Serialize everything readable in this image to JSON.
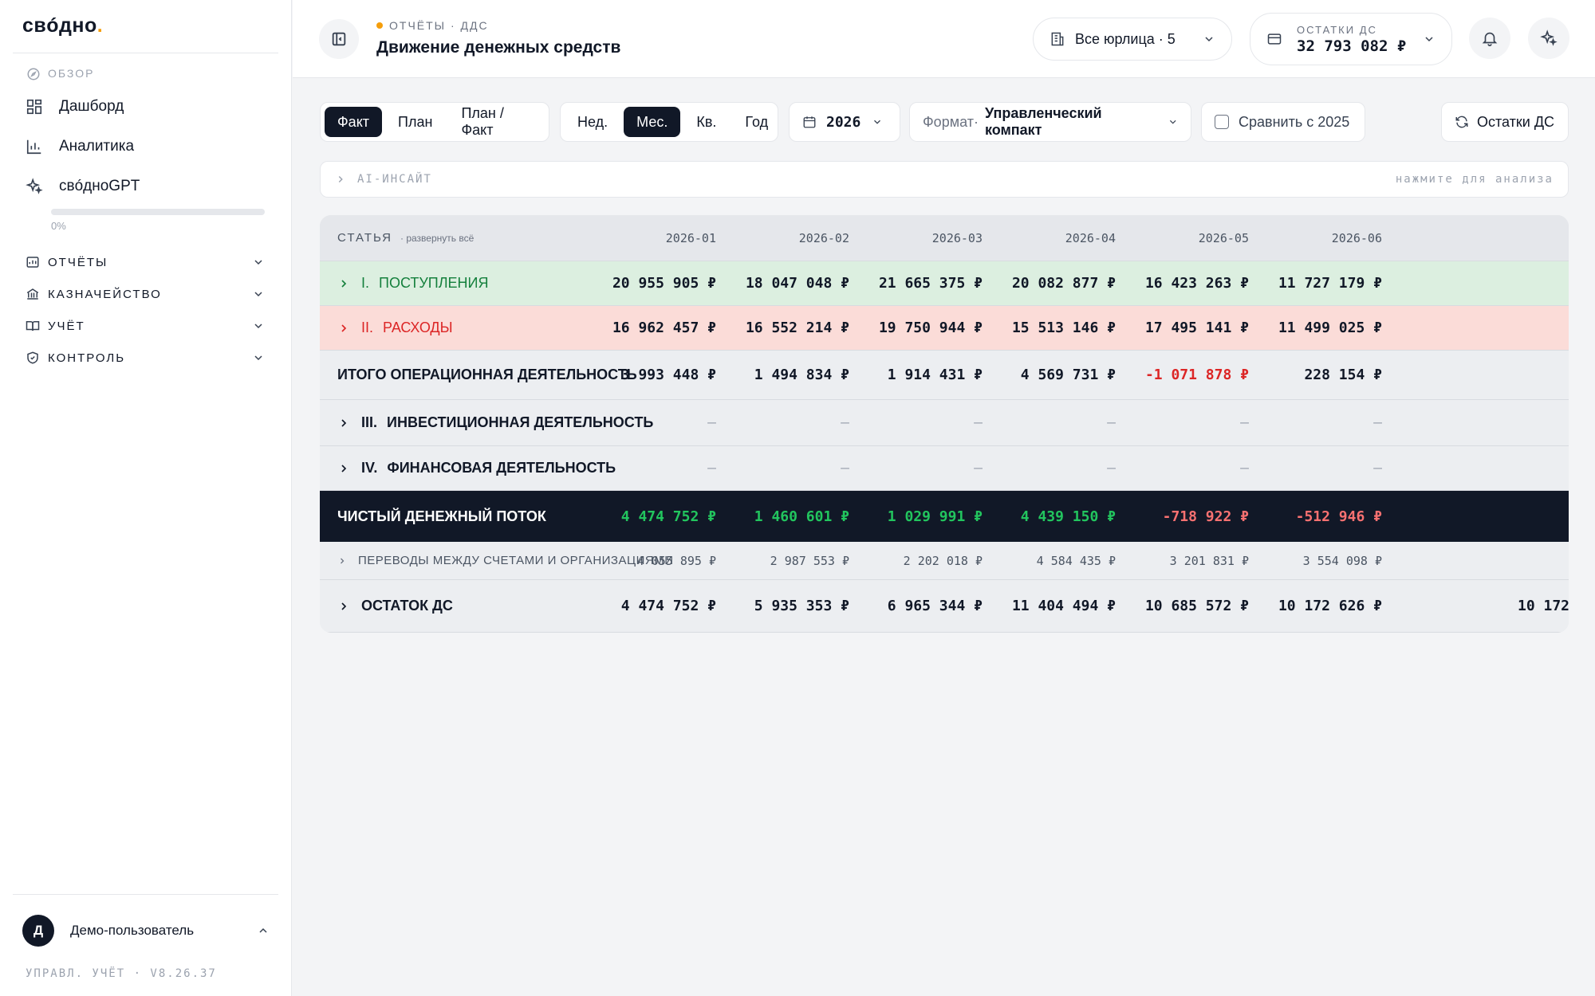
{
  "sidebar": {
    "logo": "свóдно",
    "overview_label": "ОБЗОР",
    "items": [
      {
        "label": "Дашборд",
        "icon": "dashboard-icon"
      },
      {
        "label": "Аналитика",
        "icon": "bar-chart-icon"
      },
      {
        "label": "свóдноGPT",
        "icon": "sparkles-icon"
      }
    ],
    "progress": {
      "value": 0,
      "label": "0%"
    },
    "groups": [
      {
        "label": "ОТЧЁТЫ",
        "icon": "report-icon"
      },
      {
        "label": "КАЗНАЧЕЙСТВО",
        "icon": "bank-icon"
      },
      {
        "label": "УЧЁТ",
        "icon": "book-icon"
      },
      {
        "label": "КОНТРОЛЬ",
        "icon": "shield-check-icon"
      }
    ],
    "user": {
      "initial": "Д",
      "name": "Демо-пользователь"
    },
    "version": "УПРАВЛ. УЧЁТ · V8.26.37"
  },
  "header": {
    "breadcrumb": "ОТЧЁТЫ · ДДС",
    "title": "Движение денежных средств",
    "entity_selector": "Все юрлица · 5",
    "balance_label": "ОСТАТКИ ДС",
    "balance_value": "32 793 082 ₽"
  },
  "toolbar": {
    "mode_tabs": [
      "Факт",
      "План",
      "План / Факт"
    ],
    "mode_active": 0,
    "period_tabs": [
      "Нед.",
      "Мес.",
      "Кв.",
      "Год"
    ],
    "period_active": 1,
    "year": "2026",
    "format_label": "Формат·",
    "format_value": "Управленческий компакт",
    "compare_label": "Сравнить с 2025",
    "balances_button": "Остатки ДС"
  },
  "ai_insight": {
    "label": "AI-ИНСАЙТ",
    "hint": "нажмите для анализа"
  },
  "table": {
    "header_label": "СТАТЬЯ",
    "expand_all": "· развернуть всё",
    "columns": [
      "2026-01",
      "2026-02",
      "2026-03",
      "2026-04",
      "2026-05",
      "2026-06"
    ],
    "rows": [
      {
        "num": "I.",
        "label": "ПОСТУПЛЕНИЯ",
        "values": [
          "20 955 905 ₽",
          "18 047 048 ₽",
          "21 665 375 ₽",
          "20 082 877 ₽",
          "16 423 263 ₽",
          "11 727 179 ₽"
        ]
      },
      {
        "num": "II.",
        "label": "РАСХОДЫ",
        "values": [
          "16 962 457 ₽",
          "16 552 214 ₽",
          "19 750 944 ₽",
          "15 513 146 ₽",
          "17 495 141 ₽",
          "11 499 025 ₽"
        ]
      },
      {
        "label": "ИТОГО ОПЕРАЦИОННАЯ ДЕЯТЕЛЬНОСТЬ",
        "values": [
          "3 993 448 ₽",
          "1 494 834 ₽",
          "1 914 431 ₽",
          "4 569 731 ₽",
          "-1 071 878 ₽",
          "228 154 ₽"
        ]
      },
      {
        "num": "III.",
        "label": "ИНВЕСТИЦИОННАЯ ДЕЯТЕЛЬНОСТЬ",
        "values": [
          "—",
          "—",
          "—",
          "—",
          "—",
          "—"
        ]
      },
      {
        "num": "IV.",
        "label": "ФИНАНСОВАЯ ДЕЯТЕЛЬНОСТЬ",
        "values": [
          "—",
          "—",
          "—",
          "—",
          "—",
          "—"
        ]
      },
      {
        "label": "ЧИСТЫЙ ДЕНЕЖНЫЙ ПОТОК",
        "values": [
          "4 474 752 ₽",
          "1 460 601 ₽",
          "1 029 991 ₽",
          "4 439 150 ₽",
          "-718 922 ₽",
          "-512 946 ₽"
        ]
      },
      {
        "label": "ПЕРЕВОДЫ МЕЖДУ СЧЕТАМИ И ОРГАНИЗАЦИЯМИ",
        "values": [
          "4 055 895 ₽",
          "2 987 553 ₽",
          "2 202 018 ₽",
          "4 584 435 ₽",
          "3 201 831 ₽",
          "3 554 098 ₽"
        ]
      },
      {
        "label": "ОСТАТОК ДС",
        "values": [
          "4 474 752 ₽",
          "5 935 353 ₽",
          "6 965 344 ₽",
          "11 404 494 ₽",
          "10 685 572 ₽",
          "10 172 626 ₽"
        ],
        "overflow_value": "10 172"
      }
    ]
  },
  "colors": {
    "accent": "#f59e0b",
    "positive": "#16a34a",
    "negative": "#dc2626",
    "dark_row": "#111827",
    "income_bg": "#dcefe0",
    "expense_bg": "#fbdcd8"
  }
}
